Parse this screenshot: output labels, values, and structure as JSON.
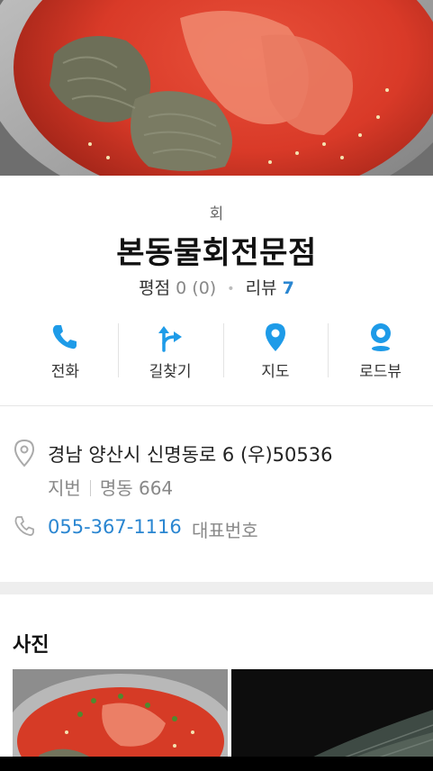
{
  "hero": {
    "image": "naengmyeon-photo"
  },
  "place": {
    "category": "회",
    "name": "본동물회전문점",
    "rating_label": "평점",
    "rating_value": "0 (0)",
    "review_label": "리뷰",
    "review_count": "7"
  },
  "actions": [
    {
      "label": "전화",
      "icon": "phone-icon"
    },
    {
      "label": "길찾기",
      "icon": "directions-icon"
    },
    {
      "label": "지도",
      "icon": "map-pin-icon"
    },
    {
      "label": "로드뷰",
      "icon": "roadview-icon"
    }
  ],
  "address": {
    "road": "경남 양산시 신명동로 6 (우)50536",
    "lot_label": "지번",
    "lot": "명동 664",
    "phone": "055-367-1116",
    "phone_type": "대표번호"
  },
  "photos": {
    "title": "사진"
  },
  "colors": {
    "accent": "#2a86d1",
    "icon_blue": "#1e9be8"
  }
}
